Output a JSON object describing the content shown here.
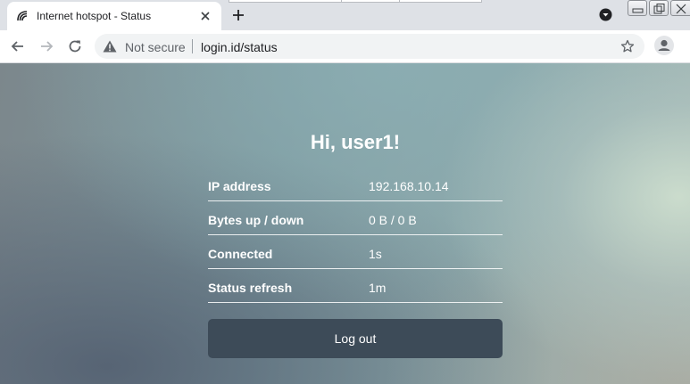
{
  "browser": {
    "tab": {
      "title": "Internet hotspot - Status",
      "favicon": "mikrotik-logo-icon"
    },
    "new_tab_icon": "plus-icon",
    "toolbar": {
      "back_icon": "arrow-left-icon",
      "forward_icon": "arrow-right-icon",
      "reload_icon": "reload-icon",
      "security_label": "Not secure",
      "url": "login.id/status",
      "bookmark_icon": "star-icon",
      "profile_icon": "person-icon"
    }
  },
  "page": {
    "greeting": "Hi, user1!",
    "rows": [
      {
        "label": "IP address",
        "value": "192.168.10.14"
      },
      {
        "label": "Bytes up / down",
        "value": "0 B / 0 B"
      },
      {
        "label": "Connected",
        "value": "1s"
      },
      {
        "label": "Status refresh",
        "value": "1m"
      }
    ],
    "logout_label": "Log out"
  },
  "colors": {
    "logout_button": "#3d4b58",
    "tabstrip": "#dee1e6",
    "omnibox": "#f1f3f4"
  }
}
